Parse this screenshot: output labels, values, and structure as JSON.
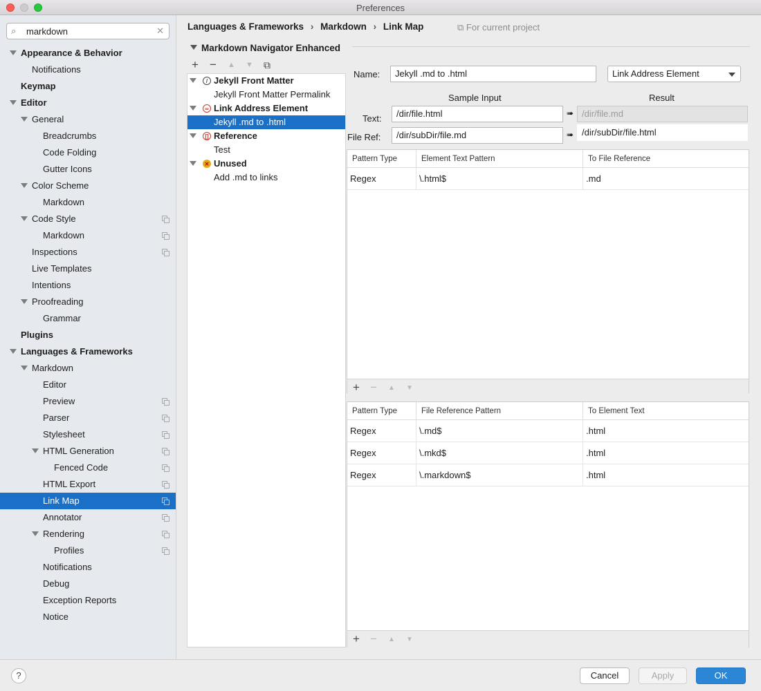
{
  "window": {
    "title": "Preferences"
  },
  "search": {
    "value": "markdown"
  },
  "sidebar": {
    "items": [
      {
        "label": "Appearance & Behavior",
        "level": 0,
        "bold": true,
        "expand": true,
        "copy": false
      },
      {
        "label": "Notifications",
        "level": 1,
        "bold": false,
        "expand": false,
        "copy": false
      },
      {
        "label": "Keymap",
        "level": 0,
        "bold": true,
        "expand": false,
        "copy": false
      },
      {
        "label": "Editor",
        "level": 0,
        "bold": true,
        "expand": true,
        "copy": false
      },
      {
        "label": "General",
        "level": 1,
        "bold": false,
        "expand": true,
        "copy": false
      },
      {
        "label": "Breadcrumbs",
        "level": 2,
        "bold": false,
        "expand": false,
        "copy": false
      },
      {
        "label": "Code Folding",
        "level": 2,
        "bold": false,
        "expand": false,
        "copy": false
      },
      {
        "label": "Gutter Icons",
        "level": 2,
        "bold": false,
        "expand": false,
        "copy": false
      },
      {
        "label": "Color Scheme",
        "level": 1,
        "bold": false,
        "expand": true,
        "copy": false
      },
      {
        "label": "Markdown",
        "level": 2,
        "bold": false,
        "expand": false,
        "copy": false
      },
      {
        "label": "Code Style",
        "level": 1,
        "bold": false,
        "expand": true,
        "copy": true
      },
      {
        "label": "Markdown",
        "level": 2,
        "bold": false,
        "expand": false,
        "copy": true
      },
      {
        "label": "Inspections",
        "level": 1,
        "bold": false,
        "expand": false,
        "copy": true
      },
      {
        "label": "Live Templates",
        "level": 1,
        "bold": false,
        "expand": false,
        "copy": false
      },
      {
        "label": "Intentions",
        "level": 1,
        "bold": false,
        "expand": false,
        "copy": false
      },
      {
        "label": "Proofreading",
        "level": 1,
        "bold": false,
        "expand": true,
        "copy": false
      },
      {
        "label": "Grammar",
        "level": 2,
        "bold": false,
        "expand": false,
        "copy": false
      },
      {
        "label": "Plugins",
        "level": 0,
        "bold": true,
        "expand": false,
        "copy": false
      },
      {
        "label": "Languages & Frameworks",
        "level": 0,
        "bold": true,
        "expand": true,
        "copy": false
      },
      {
        "label": "Markdown",
        "level": 1,
        "bold": false,
        "expand": true,
        "copy": false
      },
      {
        "label": "Editor",
        "level": 2,
        "bold": false,
        "expand": false,
        "copy": false
      },
      {
        "label": "Preview",
        "level": 2,
        "bold": false,
        "expand": false,
        "copy": true
      },
      {
        "label": "Parser",
        "level": 2,
        "bold": false,
        "expand": false,
        "copy": true
      },
      {
        "label": "Stylesheet",
        "level": 2,
        "bold": false,
        "expand": false,
        "copy": true
      },
      {
        "label": "HTML Generation",
        "level": 2,
        "bold": false,
        "expand": true,
        "copy": true
      },
      {
        "label": "Fenced Code",
        "level": 3,
        "bold": false,
        "expand": false,
        "copy": true
      },
      {
        "label": "HTML Export",
        "level": 2,
        "bold": false,
        "expand": false,
        "copy": true
      },
      {
        "label": "Link Map",
        "level": 2,
        "bold": false,
        "expand": false,
        "copy": true,
        "selected": true
      },
      {
        "label": "Annotator",
        "level": 2,
        "bold": false,
        "expand": false,
        "copy": true
      },
      {
        "label": "Rendering",
        "level": 2,
        "bold": false,
        "expand": true,
        "copy": true
      },
      {
        "label": "Profiles",
        "level": 3,
        "bold": false,
        "expand": false,
        "copy": true
      },
      {
        "label": "Notifications",
        "level": 2,
        "bold": false,
        "expand": false,
        "copy": false
      },
      {
        "label": "Debug",
        "level": 2,
        "bold": false,
        "expand": false,
        "copy": false
      },
      {
        "label": "Exception Reports",
        "level": 2,
        "bold": false,
        "expand": false,
        "copy": false
      },
      {
        "label": "Notice",
        "level": 2,
        "bold": false,
        "expand": false,
        "copy": false
      }
    ]
  },
  "breadcrumb": {
    "items": [
      "Languages & Frameworks",
      "Markdown",
      "Link Map"
    ],
    "separator": "›",
    "scope": "For current project"
  },
  "section": {
    "title": "Markdown Navigator Enhanced"
  },
  "list_toolbar": {
    "add": "+",
    "remove": "−",
    "up": "▲",
    "down": "▼"
  },
  "element_list": [
    {
      "label": "Jekyll Front Matter",
      "group": true,
      "icon": "compass-icon",
      "badge": "/",
      "badge_color": "#444444"
    },
    {
      "label": "Jekyll Front Matter Permalink",
      "group": false
    },
    {
      "label": "Link Address Element",
      "group": true,
      "icon": "link-icon",
      "badge": "∞",
      "badge_color": "#c0392b"
    },
    {
      "label": "Jekyll .md to .html",
      "group": false,
      "selected": true
    },
    {
      "label": "Reference",
      "group": true,
      "icon": "reference-icon",
      "badge": "[]",
      "badge_color": "#c0392b"
    },
    {
      "label": "Test",
      "group": false
    },
    {
      "label": "Unused",
      "group": true,
      "icon": "unused-icon",
      "badge": "✕",
      "badge_color": "#e6a817"
    },
    {
      "label": "Add .md to links",
      "group": false
    }
  ],
  "detail": {
    "name_label": "Name:",
    "name_value": "Jekyll .md to .html",
    "element_type": "Link Address Element",
    "sample_input_header": "Sample Input",
    "result_header": "Result",
    "text_label": "Text:",
    "text_value": "/dir/file.html",
    "text_result": "/dir/file.md",
    "fileref_label": "File Ref:",
    "fileref_value": "/dir/subDir/file.md",
    "fileref_result": "/dir/subDir/file.html",
    "arrow": "➠"
  },
  "table1": {
    "headers": [
      "Pattern Type",
      "Element Text Pattern",
      "To File Reference"
    ],
    "rows": [
      [
        "Regex",
        "\\.html$",
        ".md"
      ]
    ]
  },
  "table2": {
    "headers": [
      "Pattern Type",
      "File Reference Pattern",
      "To Element Text"
    ],
    "rows": [
      [
        "Regex",
        "\\.md$",
        ".html"
      ],
      [
        "Regex",
        "\\.mkd$",
        ".html"
      ],
      [
        "Regex",
        "\\.markdown$",
        ".html"
      ]
    ]
  },
  "buttons": {
    "help": "?",
    "cancel": "Cancel",
    "apply": "Apply",
    "ok": "OK"
  }
}
